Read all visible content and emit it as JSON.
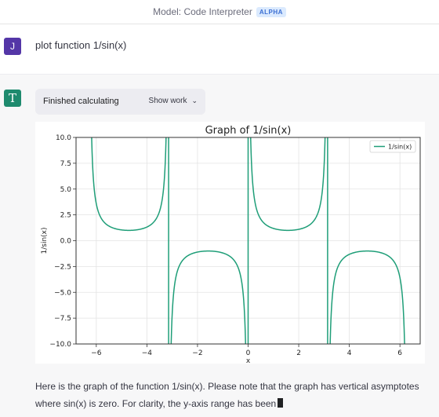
{
  "header": {
    "model_label": "Model: Code Interpreter",
    "badge": "ALPHA"
  },
  "user": {
    "avatar_letter": "J",
    "message": "plot function 1/sin(x)"
  },
  "assistant": {
    "avatar_glyph": "T",
    "status_label": "Finished calculating",
    "show_work_label": "Show work",
    "response_text": "Here is the graph of the function 1/sin(x). Please note that the graph has vertical asymptotes where sin(x) is zero. For clarity, the y-axis range has been"
  },
  "icons": {
    "chevron": "chevron-down-icon"
  },
  "colors": {
    "series": "#1f9e78",
    "user_avatar": "#5436a7",
    "bot_avatar": "#1e8a6e"
  },
  "chart_data": {
    "type": "line",
    "title": "Graph of 1/sin(x)",
    "xlabel": "x",
    "ylabel": "1/sin(x)",
    "xlim": [
      -6.8,
      6.8
    ],
    "ylim": [
      -10,
      10
    ],
    "xticks": [
      -6,
      -4,
      -2,
      0,
      2,
      4,
      6
    ],
    "xtick_labels": [
      "−6",
      "−4",
      "−2",
      "0",
      "2",
      "4",
      "6"
    ],
    "yticks": [
      10,
      7.5,
      5,
      2.5,
      0,
      -2.5,
      -5,
      -7.5,
      -10
    ],
    "ytick_labels": [
      "10.0",
      "7.5",
      "5.0",
      "2.5",
      "0.0",
      "−2.5",
      "−5.0",
      "−7.5",
      "−10.0"
    ],
    "grid": true,
    "legend_position": "top-right",
    "series": [
      {
        "name": "1/sin(x)",
        "function": "1/sin(x)",
        "x_range": [
          -6.283,
          6.283
        ]
      }
    ]
  }
}
